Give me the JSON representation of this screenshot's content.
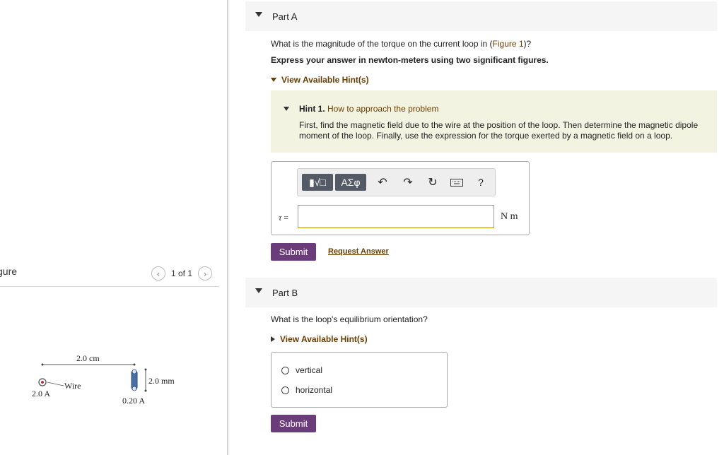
{
  "figure": {
    "title": "gure",
    "page_indicator": "1 of 1",
    "labels": {
      "width": "2.0 cm",
      "wire": "Wire",
      "wire_current": "2.0 A",
      "loop_height": "2.0 mm",
      "loop_current": "0.20 A"
    }
  },
  "part_a": {
    "title": "Part A",
    "question_prefix": "What is the magnitude of the torque on the current loop in (",
    "question_link": "Figure 1",
    "question_suffix": ")?",
    "instruction": "Express your answer in newton-meters using two significant figures.",
    "hints_toggle": "View Available Hint(s)",
    "hint": {
      "number": "Hint 1.",
      "title": "How to approach the problem",
      "body": "First, find the magnetic field due to the wire at the position of the loop. Then determine the magnetic dipole moment of the loop. Finally, use the expression for the torque exerted by a magnetic field on a loop."
    },
    "toolbar": {
      "template_btn": "▮√□",
      "greek_btn": "AΣφ",
      "help": "?"
    },
    "answer_label": "τ",
    "answer_equals": " =",
    "answer_value": "",
    "unit": "N m",
    "submit": "Submit",
    "request_answer": "Request Answer"
  },
  "part_b": {
    "title": "Part B",
    "question": "What is the loop's equilibrium orientation?",
    "hints_toggle": "View Available Hint(s)",
    "options": [
      "vertical",
      "horizontal"
    ],
    "submit": "Submit"
  }
}
